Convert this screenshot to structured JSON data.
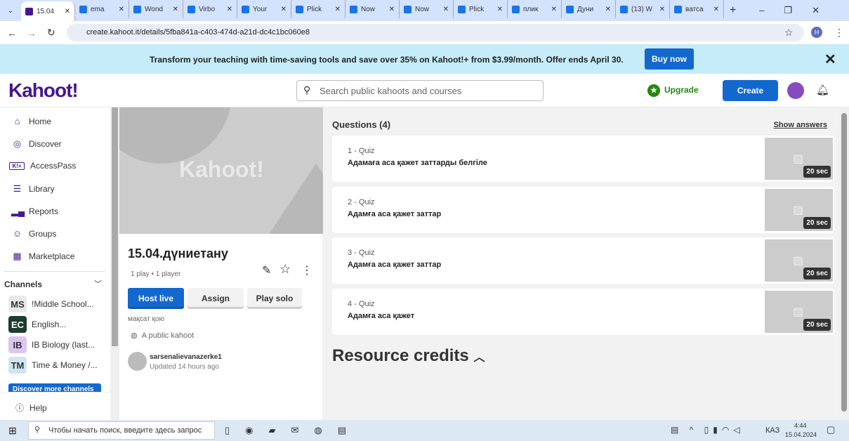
{
  "browser": {
    "tabs": [
      "15.04",
      "ema",
      "Wond",
      "Virbo",
      "Your",
      "Plick",
      "Now",
      "Now",
      "Plick",
      "плик",
      "Дуни",
      "(13) W",
      "ватса"
    ],
    "url": "create.kahoot.it/details/5fba841a-c403-474d-a21d-dc4c1bc060e8",
    "profile": "H"
  },
  "banner": {
    "text": "Transform your teaching with time-saving tools and save over 35% on Kahoot!+ from $3.99/month. Offer ends April 30.",
    "buy": "Buy now"
  },
  "header": {
    "logo": "Kahoot!",
    "search_placeholder": "Search public kahoots and courses",
    "upgrade": "Upgrade",
    "create": "Create"
  },
  "sidebar": {
    "items": [
      "Home",
      "Discover",
      "AccessPass",
      "Library",
      "Reports",
      "Groups",
      "Marketplace"
    ],
    "channels_title": "Channels",
    "channels": [
      {
        "abbr": "MS",
        "name": "!Middle School..."
      },
      {
        "abbr": "EC",
        "name": "English..."
      },
      {
        "abbr": "IB",
        "name": "IB Biology (last..."
      },
      {
        "abbr": "TM",
        "name": "Time & Money /..."
      }
    ],
    "discover_more": "Discover more channels",
    "help": "Help"
  },
  "card": {
    "cover_logo": "Kahoot!",
    "title": "15.04.дүниетану",
    "stats": "1 play • 1 player",
    "host": "Host live",
    "assign": "Assign",
    "solo": "Play solo",
    "description": "мақсат қою",
    "visibility": "A public kahoot",
    "author": "sarsenalievanazerke1",
    "updated": "Updated 14 hours ago"
  },
  "main": {
    "questions_title": "Questions (4)",
    "show_answers": "Show answers",
    "questions": [
      {
        "n": "1 - Quiz",
        "t": "Адамаға аса қажет заттарды белгіле",
        "time": "20 sec"
      },
      {
        "n": "2 - Quiz",
        "t": "Адамға аса қажет заттар",
        "time": "20 sec"
      },
      {
        "n": "3 - Quiz",
        "t": "Адамға аса қажет заттар",
        "time": "20 sec"
      },
      {
        "n": "4 - Quiz",
        "t": "Адамға аса қажет",
        "time": "20 sec"
      }
    ],
    "credits": "Resource credits"
  },
  "taskbar": {
    "search": "Чтобы начать поиск, введите здесь запрос",
    "lang": "КАЗ",
    "time": "4:44",
    "date": "15.04.2024"
  }
}
